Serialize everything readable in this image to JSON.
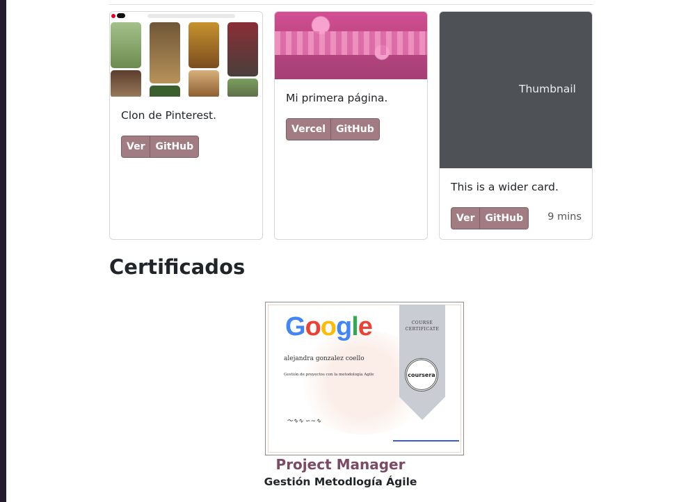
{
  "cards": [
    {
      "text": "Clon de Pinterest.",
      "buttons": [
        "Ver",
        "GitHub"
      ],
      "thumbnail": "pinterest-clone-screenshot"
    },
    {
      "text": "Mi primera página.",
      "buttons": [
        "Vercel",
        "GitHub"
      ],
      "thumbnail": "first-page-screenshot"
    },
    {
      "thumbnail_label": "Thumbnail",
      "text": "This is a wider card.",
      "buttons": [
        "Ver",
        "GitHub"
      ],
      "time": "9 mins"
    }
  ],
  "section": {
    "title": "Certificados"
  },
  "certificate": {
    "logo_text": [
      "G",
      "o",
      "o",
      "g",
      "l",
      "e"
    ],
    "ribbon_text": "COURSE CERTIFICATE",
    "seal_text": "coursera",
    "recipient": "alejandra gonzalez coello",
    "course": "Gestión de proyectos con la metodología Agile",
    "title": "Project Manager",
    "subtitle": "Gestión Metodlogía Ágile"
  },
  "colors": {
    "button_bg": "#a27c83",
    "thumbnail_bg": "#4e5256",
    "cert_title": "#7b4a64",
    "google": [
      "#4285F4",
      "#EA4335",
      "#FBBC05",
      "#4285F4",
      "#34A853",
      "#EA4335"
    ]
  }
}
